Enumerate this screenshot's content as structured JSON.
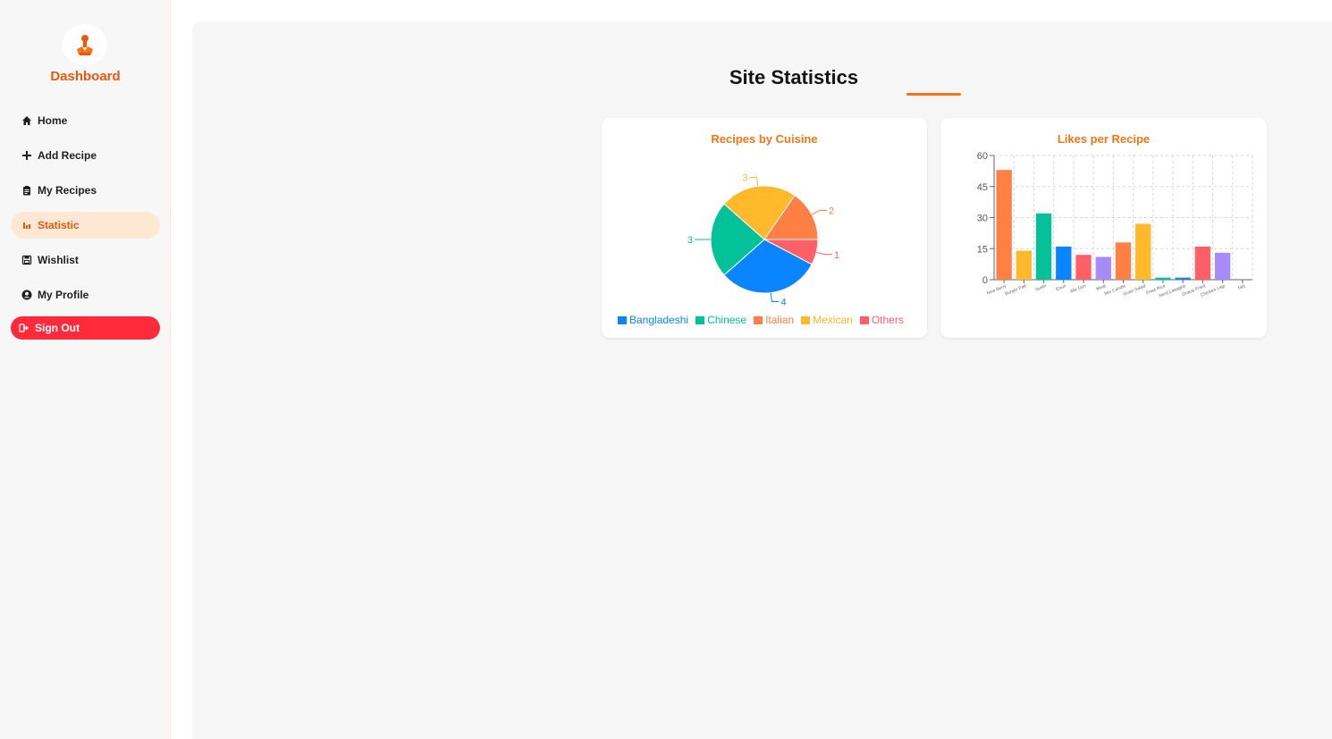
{
  "sidebar": {
    "brand": "Dashboard",
    "items": [
      {
        "label": "Home",
        "icon": "home-icon"
      },
      {
        "label": "Add Recipe",
        "icon": "plus-icon"
      },
      {
        "label": "My Recipes",
        "icon": "clipboard-icon"
      },
      {
        "label": "Statistic",
        "icon": "bar-chart-icon",
        "active": true
      },
      {
        "label": "Wishlist",
        "icon": "save-icon"
      },
      {
        "label": "My Profile",
        "icon": "user-circle-icon"
      }
    ],
    "signout": {
      "label": "Sign Out",
      "icon": "sign-out-icon"
    }
  },
  "colors": {
    "accent": "#f97316",
    "brand": "#ea580c",
    "active_bg": "#fde9d3",
    "signout_bg": "#ff2a3a",
    "blue": "#0a84ff",
    "teal": "#03c29a",
    "orange": "#ff7f45",
    "yellow": "#ffb92a",
    "red": "#ff6068",
    "purple": "#a78bfa"
  },
  "main": {
    "title": "Site Statistics"
  },
  "chart_data": [
    {
      "type": "pie",
      "title": "Recipes by Cuisine",
      "categories": [
        "Bangladeshi",
        "Chinese",
        "Italian",
        "Mexican",
        "Others"
      ],
      "values": [
        4,
        3,
        2,
        3,
        1
      ],
      "colors": [
        "#0a84ff",
        "#03c29a",
        "#ff7f45",
        "#ffb92a",
        "#ff6068"
      ],
      "legend": "bottom"
    },
    {
      "type": "bar",
      "title": "Likes per Recipe",
      "categories": [
        "New Berry",
        "Burger Patt",
        "Sushi",
        "Enuri",
        "Mix Dim",
        "Meat",
        "Mix Candie",
        "Grain Salad",
        "Fried Rice",
        "Nerd Lasagna",
        "Dracis Fried",
        "Chicken Legi",
        "faiij"
      ],
      "values": [
        53,
        14,
        32,
        16,
        12,
        11,
        18,
        27,
        1,
        1,
        16,
        13,
        0
      ],
      "colors": [
        "#ff7f45",
        "#ffb92a",
        "#03c29a",
        "#0a84ff",
        "#ff6068",
        "#a78bfa",
        "#ff7f45",
        "#ffb92a",
        "#03c29a",
        "#0a84ff",
        "#ff6068",
        "#a78bfa",
        "#ff7f45"
      ],
      "ylim": [
        0,
        60
      ],
      "yticks": [
        0,
        15,
        30,
        45,
        60
      ],
      "grid": true
    }
  ]
}
